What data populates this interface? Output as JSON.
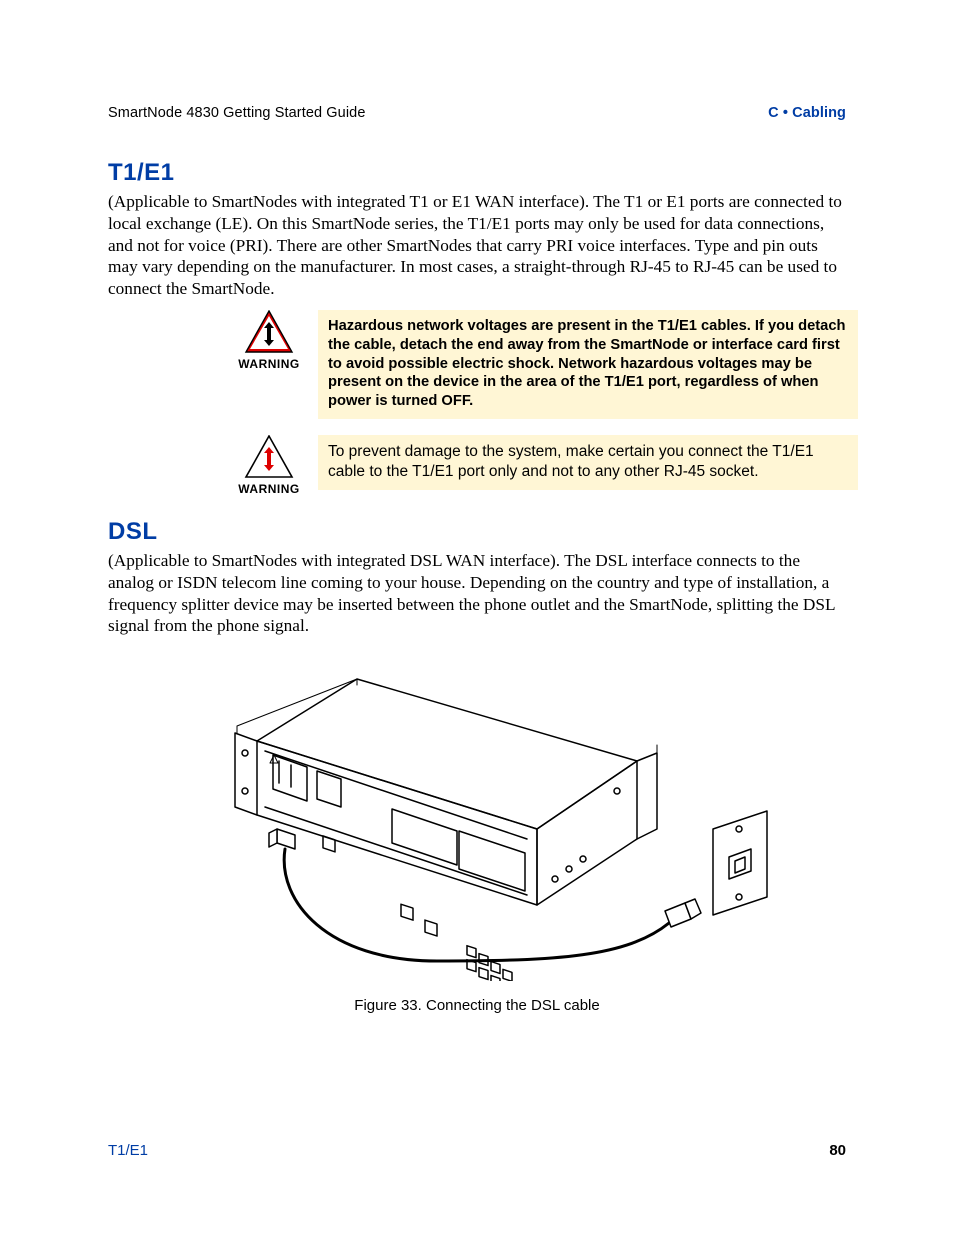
{
  "header": {
    "left": "SmartNode 4830 Getting Started Guide",
    "right": "C • Cabling"
  },
  "section1": {
    "heading": "T1/E1",
    "body": "(Applicable to SmartNodes with integrated T1 or E1 WAN interface). The T1 or E1 ports are connected to local exchange (LE). On this SmartNode series, the T1/E1 ports may only be used for data connections, and not for voice (PRI). There are other SmartNodes that carry PRI voice interfaces. Type and pin outs may vary depending on the manufacturer. In most cases, a straight-through RJ-45 to RJ-45 can be used to connect the SmartNode."
  },
  "warning_label": "WARNING",
  "warning1": "Hazardous network voltages are present in the T1/E1 cables. If you detach the cable, detach the end away from the SmartNode or interface card first to avoid possible electric shock. Network hazardous voltages may be present on the device in the area of the T1/E1 port, regardless of when power is turned OFF.",
  "warning2": "To prevent damage to the system, make certain you connect the T1/E1 cable to the T1/E1 port only and not to any other RJ-45 socket.",
  "section2": {
    "heading": "DSL",
    "body": "(Applicable to SmartNodes with integrated DSL WAN interface). The DSL interface connects to the analog or ISDN telecom line coming to your house. Depending on the country and type of installation, a frequency splitter device may be inserted between the phone outlet and the SmartNode, splitting the DSL signal from the phone signal."
  },
  "figure": {
    "caption": "Figure 33. Connecting the DSL cable"
  },
  "footer": {
    "left": "T1/E1",
    "right": "80"
  }
}
